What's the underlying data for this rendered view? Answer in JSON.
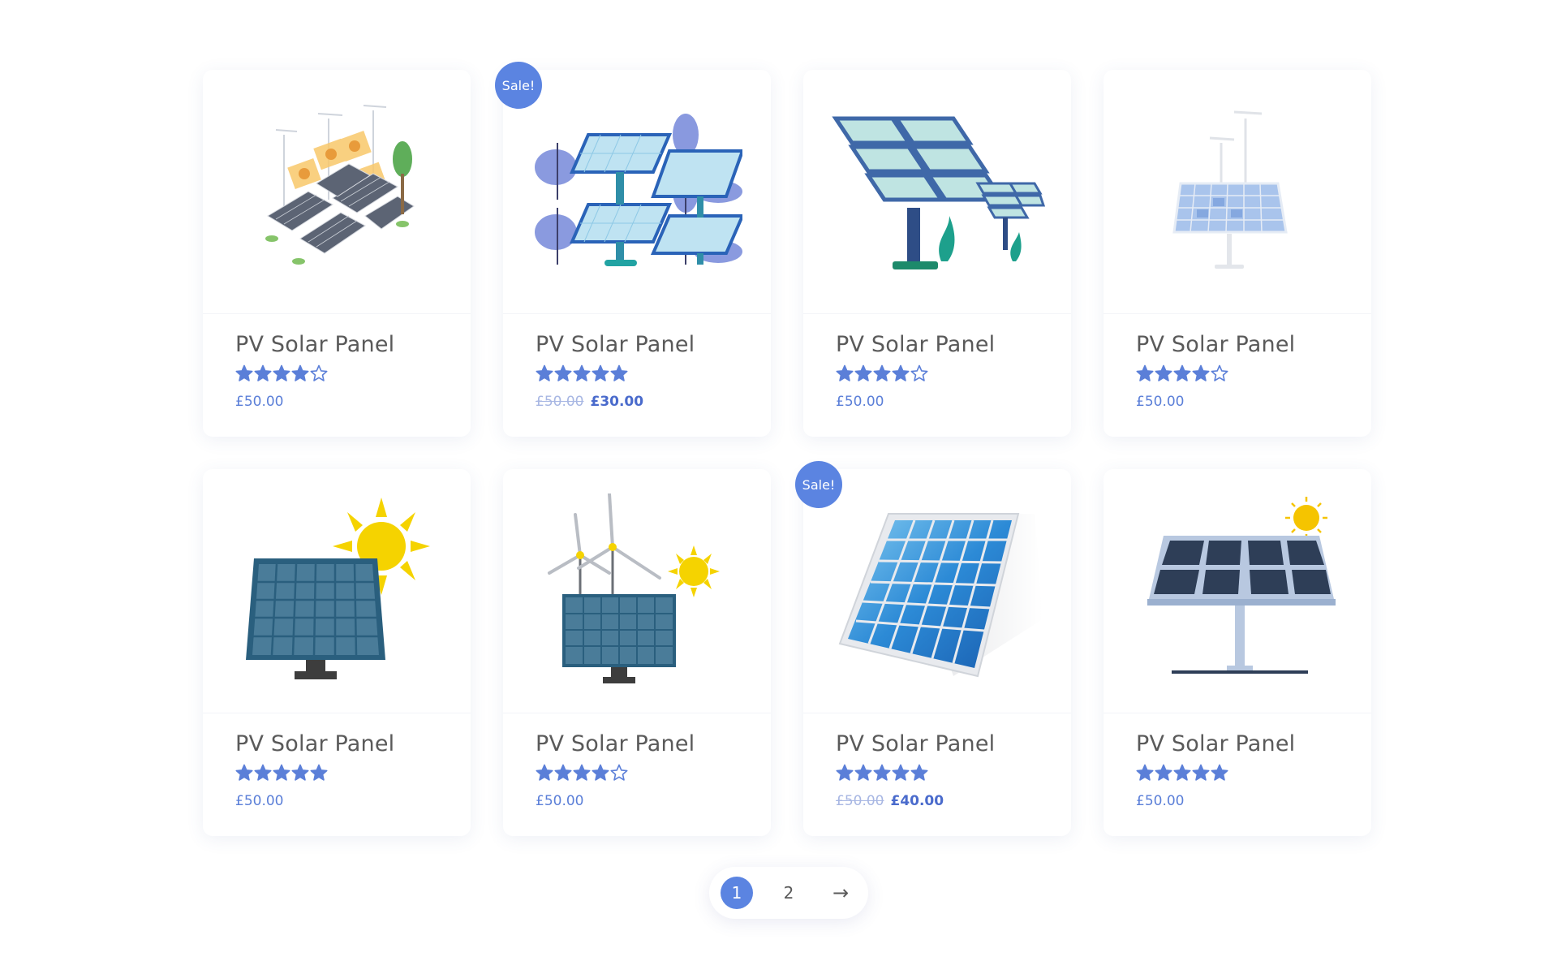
{
  "colors": {
    "accent": "#5b84e1",
    "price": "#5b7fd8",
    "title": "#5a5a5a",
    "star": "#5b7fd8"
  },
  "products": [
    {
      "title": "PV Solar Panel",
      "rating": 4,
      "max_rating": 5,
      "price": "£50.00",
      "old_price": "",
      "sale": false,
      "sale_label": "",
      "image": "isometric-solar-farm-illustration"
    },
    {
      "title": "PV Solar Panel",
      "rating": 5,
      "max_rating": 5,
      "price": "£30.00",
      "old_price": "£50.00",
      "sale": true,
      "sale_label": "Sale!",
      "image": "solar-panels-with-trees-illustration"
    },
    {
      "title": "PV Solar Panel",
      "rating": 4,
      "max_rating": 5,
      "price": "£50.00",
      "old_price": "",
      "sale": false,
      "sale_label": "",
      "image": "large-solar-panel-on-stand-illustration"
    },
    {
      "title": "PV Solar Panel",
      "rating": 4,
      "max_rating": 5,
      "price": "£50.00",
      "old_price": "",
      "sale": false,
      "sale_label": "",
      "image": "solar-panel-with-wind-turbines-illustration"
    },
    {
      "title": "PV Solar Panel",
      "rating": 5,
      "max_rating": 5,
      "price": "£50.00",
      "old_price": "",
      "sale": false,
      "sale_label": "",
      "image": "dark-blue-panel-with-sun-illustration"
    },
    {
      "title": "PV Solar Panel",
      "rating": 4,
      "max_rating": 5,
      "price": "£50.00",
      "old_price": "",
      "sale": false,
      "sale_label": "",
      "image": "panel-with-turbines-and-sun-illustration"
    },
    {
      "title": "PV Solar Panel",
      "rating": 5,
      "max_rating": 5,
      "price": "£40.00",
      "old_price": "£50.00",
      "sale": true,
      "sale_label": "Sale!",
      "image": "blue-photovoltaic-module-illustration"
    },
    {
      "title": "PV Solar Panel",
      "rating": 5,
      "max_rating": 5,
      "price": "£50.00",
      "old_price": "",
      "sale": false,
      "sale_label": "",
      "image": "flat-panel-on-pole-with-sun-illustration"
    }
  ],
  "pagination": {
    "pages": [
      "1",
      "2"
    ],
    "current": "1",
    "next_label": "→"
  }
}
